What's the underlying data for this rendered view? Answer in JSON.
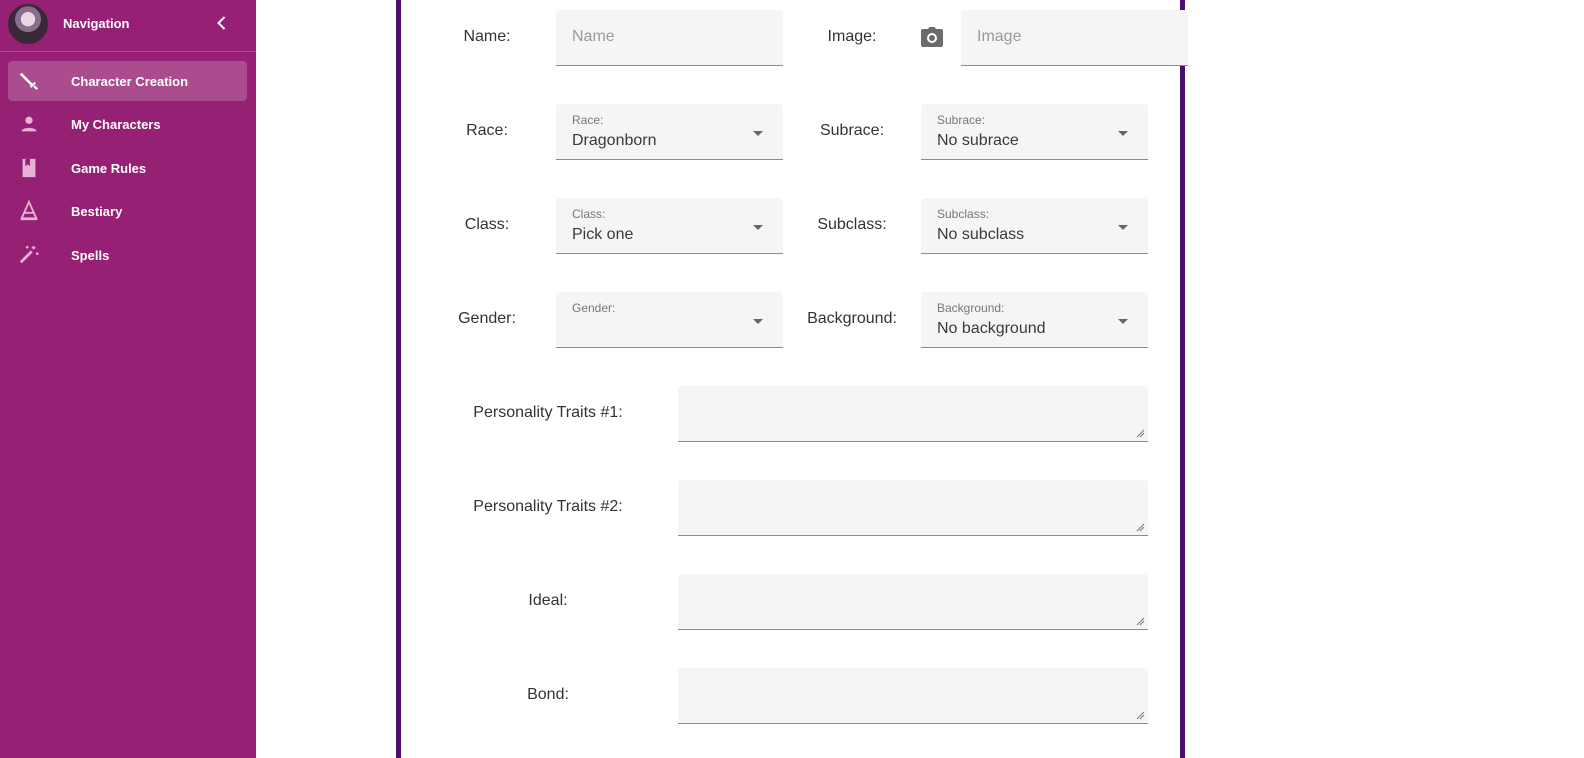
{
  "sidebar": {
    "title": "Navigation",
    "items": [
      {
        "label": "Character Creation",
        "icon": "sword-icon",
        "active": true
      },
      {
        "label": "My Characters",
        "icon": "person-icon"
      },
      {
        "label": "Game Rules",
        "icon": "book-icon"
      },
      {
        "label": "Bestiary",
        "icon": "monster-icon"
      },
      {
        "label": "Spells",
        "icon": "magic-wand-icon"
      }
    ]
  },
  "form": {
    "name": {
      "label": "Name:",
      "placeholder": "Name"
    },
    "image": {
      "label": "Image:",
      "placeholder": "Image"
    },
    "race": {
      "label": "Race:",
      "field_label": "Race:",
      "value": "Dragonborn"
    },
    "subrace": {
      "label": "Subrace:",
      "field_label": "Subrace:",
      "value": "No subrace"
    },
    "class": {
      "label": "Class:",
      "field_label": "Class:",
      "value": "Pick one"
    },
    "subclass": {
      "label": "Subclass:",
      "field_label": "Subclass:",
      "value": "No subclass"
    },
    "gender": {
      "label": "Gender:",
      "field_label": "Gender:",
      "value": ""
    },
    "background": {
      "label": "Background:",
      "field_label": "Background:",
      "value": "No background"
    },
    "personality1": {
      "label": "Personality Traits #1:",
      "value": ""
    },
    "personality2": {
      "label": "Personality Traits #2:",
      "value": ""
    },
    "ideal": {
      "label": "Ideal:",
      "value": ""
    },
    "bond": {
      "label": "Bond:",
      "value": ""
    }
  },
  "colors": {
    "sidebar_bg": "#962074",
    "panel_border": "#4a0f6e",
    "field_bg": "#f5f5f5"
  }
}
